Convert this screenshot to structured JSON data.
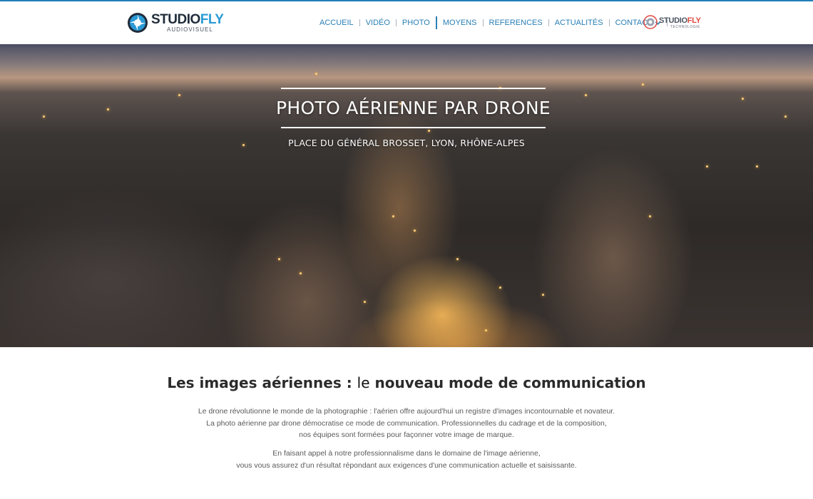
{
  "header": {
    "logo": {
      "name": "STUDIO",
      "accent": "FLY",
      "subtitle": "AUDIOVISUEL"
    },
    "nav": [
      {
        "label": "ACCUEIL"
      },
      {
        "label": "VIDÉO"
      },
      {
        "label": "PHOTO"
      },
      {
        "label": "MOYENS"
      },
      {
        "label": "REFERENCES"
      },
      {
        "label": "ACTUALITÉS"
      },
      {
        "label": "CONTACT",
        "icon": "chevron-down-icon"
      }
    ],
    "logo2": {
      "name": "STUDIO",
      "accent": "FLY",
      "subtitle": "TECHNOLOGIE"
    }
  },
  "hero": {
    "title": "PHOTO AÉRIENNE PAR DRONE",
    "subtitle": "PLACE DU GÉNÉRAL BROSSET, LYON, RHÔNE-ALPES"
  },
  "content": {
    "title_part1": "Les images aériennes : ",
    "title_strong": "le",
    "title_part2": " nouveau mode de communication",
    "p1_lines": [
      "Le drone révolutionne le monde de la photographie : l'aérien offre aujourd'hui un registre d'images incontournable et novateur.",
      "La photo aérienne par drone démocratise ce mode de communication. Professionnelles du cadrage et de la composition,",
      "nos équipes sont formées pour façonner votre image de marque."
    ],
    "p2_lines": [
      "En faisant appel à notre professionnalisme dans le domaine de l'image aérienne,",
      "vous vous assurez d'un résultat répondant aux exigences d'une communication actuelle et saisissante."
    ]
  },
  "colors": {
    "brand_blue": "#1f7fb7",
    "nav_text": "#2a7fb5",
    "logo2_accent": "#e0473d"
  }
}
